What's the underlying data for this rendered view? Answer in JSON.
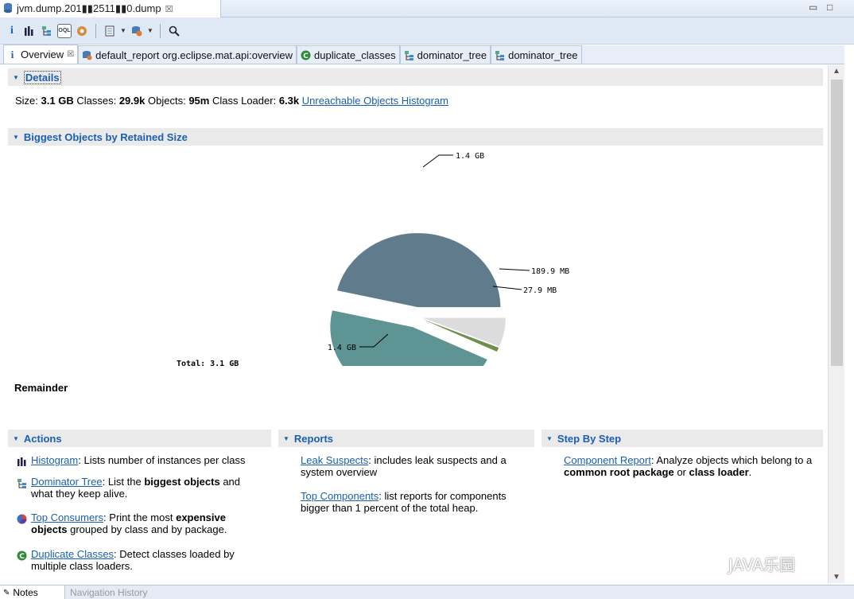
{
  "editor": {
    "tab_title": "jvm.dump.201▮▮2511▮▮0.dump",
    "close": "☒"
  },
  "toolbar": {
    "icons": [
      "info-icon",
      "histogram-icon",
      "dominator-tree-icon",
      "oql-icon",
      "heap-dump-overview-icon",
      "query-browser-icon",
      "leak-suspects-icon",
      "search-icon"
    ]
  },
  "subtabs": [
    {
      "label": "Overview",
      "close": "☒",
      "icon": "info-icon"
    },
    {
      "label": "default_report  org.eclipse.mat.api:overview",
      "icon": "report-icon"
    },
    {
      "label": "duplicate_classes",
      "icon": "duplicate-classes-icon"
    },
    {
      "label": "dominator_tree",
      "icon": "dominator-tree-icon"
    },
    {
      "label": "dominator_tree",
      "icon": "dominator-tree-icon"
    }
  ],
  "details": {
    "header": "Details",
    "size_label": "Size:",
    "size_value": "3.1 GB",
    "classes_label": "Classes:",
    "classes_value": "29.9k",
    "objects_label": "Objects:",
    "objects_value": "95m",
    "loader_label": "Class Loader:",
    "loader_value": "6.3k",
    "unreachable_link": "Unreachable Objects Histogram"
  },
  "biggest": {
    "header": "Biggest Objects by Retained Size",
    "total_label": "Total: 3.1 GB",
    "remainder_label": "Remainder"
  },
  "chart_data": {
    "type": "pie",
    "slices": [
      {
        "label": "1.4 GB",
        "value": 1.4,
        "unit": "GB",
        "color": "#5f7b8c"
      },
      {
        "label": "189.9 MB",
        "value": 0.1899,
        "unit": "GB",
        "color": "#dcdcdc"
      },
      {
        "label": "27.9 MB",
        "value": 0.0279,
        "unit": "GB",
        "color": "#6f8f4e"
      },
      {
        "label": "1.4 GB",
        "value": 1.4,
        "unit": "GB",
        "color": "#5f9494"
      }
    ],
    "total": "Total: 3.1 GB"
  },
  "actions": {
    "header": "Actions",
    "items": [
      {
        "link": "Histogram",
        "text": ": Lists number of instances per class"
      },
      {
        "link": "Dominator Tree",
        "text_a": ": List the ",
        "bold": "biggest objects",
        "text_b": " and what they keep alive."
      },
      {
        "link": "Top Consumers",
        "text_a": ": Print the most ",
        "bold": "expensive objects",
        "text_b": " grouped by class and by package."
      },
      {
        "link": "Duplicate Classes",
        "text": ": Detect classes loaded by multiple class loaders."
      }
    ]
  },
  "reports": {
    "header": "Reports",
    "items": [
      {
        "link": "Leak Suspects",
        "text": ": includes leak suspects and a system overview"
      },
      {
        "link": "Top Components",
        "text": ": list reports for components bigger than 1 percent of the total heap."
      }
    ]
  },
  "stepbystep": {
    "header": "Step By Step",
    "items": [
      {
        "link": "Component Report",
        "text_a": ": Analyze objects which belong to a ",
        "bold1": "common root package",
        "mid": " or ",
        "bold2": "class loader",
        "text_b": "."
      }
    ]
  },
  "bottom": {
    "tab1": "Notes",
    "tab2": "Navigation History"
  },
  "watermark": "JAVA乐园",
  "colors": {
    "link": "#1a5fb4",
    "header_bg": "#eaeaea",
    "toolbar_bg": "#dfe9f5"
  }
}
